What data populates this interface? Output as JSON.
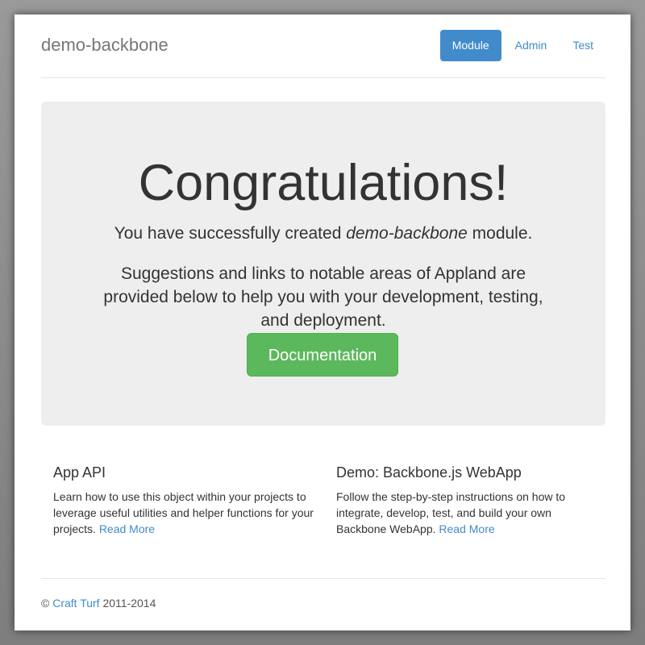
{
  "header": {
    "brand": "demo-backbone",
    "nav": [
      {
        "label": "Module",
        "active": true
      },
      {
        "label": "Admin",
        "active": false
      },
      {
        "label": "Test",
        "active": false
      }
    ]
  },
  "jumbotron": {
    "heading": "Congratulations!",
    "lead_prefix": "You have successfully created ",
    "lead_module": "demo-backbone",
    "lead_suffix": " module.",
    "suggestions": "Suggestions and links to notable areas of Appland are provided below to help you with your development, testing, and deployment.",
    "button_label": "Documentation"
  },
  "columns": [
    {
      "title": "App API",
      "text": "Learn how to use this object within your projects to leverage useful utilities and helper functions for your projects. ",
      "link": "Read More"
    },
    {
      "title": "Demo: Backbone.js WebApp",
      "text": "Follow the step-by-step instructions on how to integrate, develop, test, and build your own Backbone WebApp. ",
      "link": "Read More"
    }
  ],
  "footer": {
    "copyright_symbol": "©",
    "company": "Craft Turf",
    "years": " 2011-2014"
  },
  "colors": {
    "primary": "#428bca",
    "success": "#5cb85c",
    "jumbotron_bg": "#eeeeee"
  }
}
